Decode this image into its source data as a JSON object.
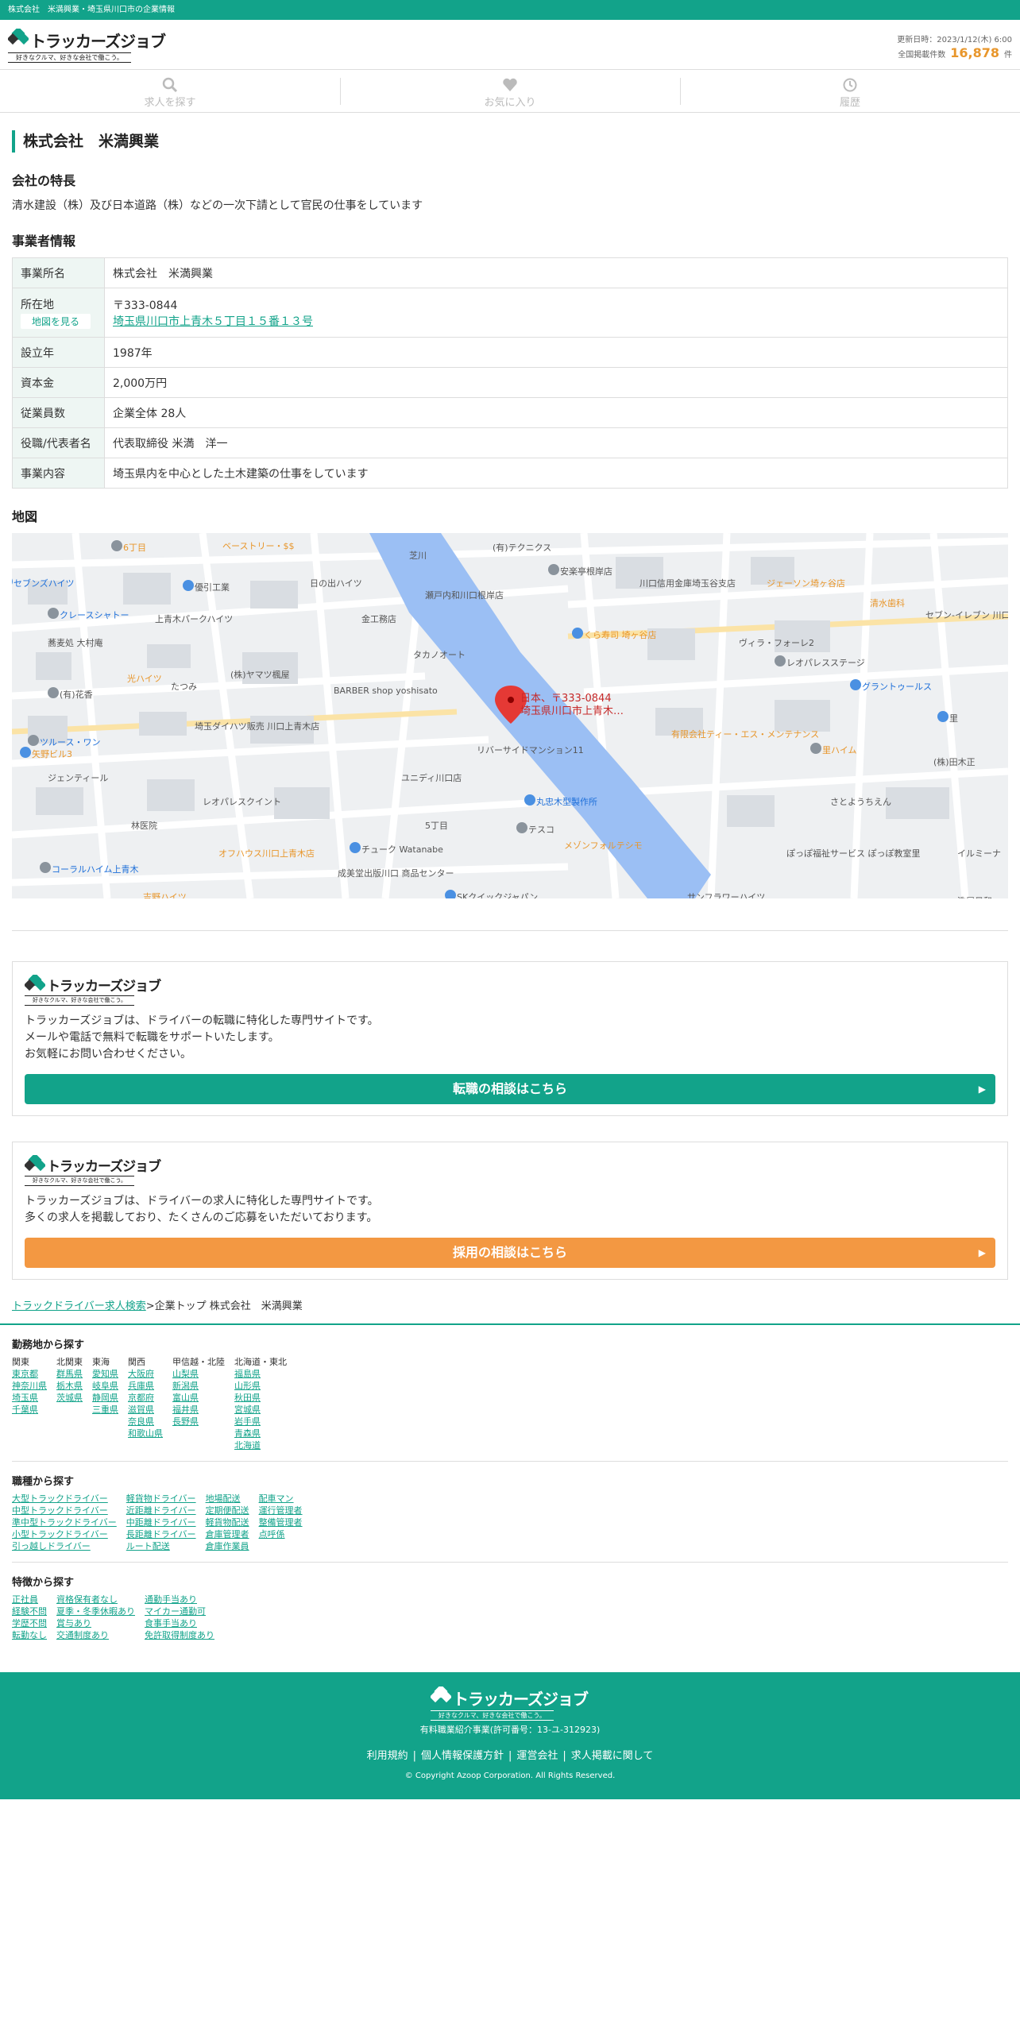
{
  "topbar": {
    "text": "株式会社　米満興業・埼玉県川口市の企業情報"
  },
  "header": {
    "logo_name": "トラッカーズジョブ",
    "logo_tagline": "好きなクルマ、好きな会社で働こう。",
    "updated": "更新日時：2023/1/12(木) 6:00",
    "count_label": "全国掲載件数",
    "count": "16,878",
    "count_unit": "件"
  },
  "nav": {
    "search": "求人を探す",
    "favorite": "お気に入り",
    "history": "履歴"
  },
  "company": {
    "name": "株式会社　米満興業",
    "feature_heading": "会社の特長",
    "feature": "清水建設（株）及び日本道路（株）などの一次下請として官民の仕事をしています",
    "info_heading": "事業者情報",
    "rows": [
      {
        "k": "事業所名",
        "v": "株式会社　米満興業"
      },
      {
        "k": "所在地",
        "zip": "〒333-0844",
        "addr": "埼玉県川口市上青木５丁目１５番１３号",
        "map_btn": "地図を見る"
      },
      {
        "k": "設立年",
        "v": "1987年"
      },
      {
        "k": "資本金",
        "v": "2,000万円"
      },
      {
        "k": "従業員数",
        "v": "企業全体 28人"
      },
      {
        "k": "役職/代表者名",
        "v": "代表取締役 米満　洋一"
      },
      {
        "k": "事業内容",
        "v": "埼玉県内を中心とした土木建築の仕事をしています"
      }
    ],
    "map_heading": "地図"
  },
  "map": {
    "pin_label1": "日本、〒333-0844",
    "pin_label2": "埼玉県川口市上青木…",
    "labels": [
      "6丁目",
      "ベーストリー・$$",
      "(有)テクニクス",
      "セブンズハイツ",
      "日の出ハイツ",
      "芝川",
      "安楽亭根岸店",
      "川口信用金庫埼玉谷支店",
      "ジェーソン埼ヶ谷店",
      "優引工業",
      "瀬戸内和川口根岸店",
      "清水歯科",
      "クレースシャトー",
      "上青木パークハイツ",
      "金工務店",
      "くら寿司 埼ヶ谷店",
      "セブン-イレブン 川口里中央店",
      "ヴィラ・フォーレ2",
      "レオパレスステージ",
      "蕎麦処 大村庵",
      "タカノオート",
      "グラントゥールス",
      "光ハイツ",
      "(株)ヤマツ楓屋",
      "(有)花香",
      "たつみ",
      "BARBER shop yoshisato",
      "里",
      "埼玉ダイハツ販売 川口上青木店",
      "有限会社ティー・エス・メンテナンス",
      "ツルース・ワン",
      "リバーサイドマンション11",
      "(株)田木正",
      "矢野ビル3",
      "ジェンティール",
      "ユニディ川口店",
      "里ハイム",
      "さとようちえん",
      "レオパレスクイント",
      "丸忠木型製作所",
      "林医院",
      "5丁目",
      "テスコ",
      "メゾンフォルテシモ",
      "オフハウス川口上青木店",
      "チューク Watanabe",
      "イルミーナ",
      "ぽっぽ福祉サービス ぽっぽ教室里",
      "コーラルハイム上青木",
      "成美堂出版川口 商品センター",
      "吉野ハイツ",
      "SKクイックジャパン",
      "サンフラワーハイツ",
      "洗屋日和"
    ]
  },
  "promo1": {
    "text": [
      "トラッカーズジョブは、ドライバーの転職に特化した専門サイトです。",
      "メールや電話で無料で転職をサポートいたします。",
      "お気軽にお問い合わせください。"
    ],
    "button": "転職の相談はこちら"
  },
  "promo2": {
    "text": [
      "トラッカーズジョブは、ドライバーの求人に特化した専門サイトです。",
      "多くの求人を掲載しており、たくさんのご応募をいただいております。"
    ],
    "button": "採用の相談はこちら"
  },
  "breadcrumb": {
    "link": "トラックドライバー求人検索",
    "sep": ">",
    "rest": "企業トップ 株式会社　米満興業"
  },
  "area": {
    "heading": "勤務地から探す",
    "cols": [
      {
        "h": "関東",
        "items": [
          "東京都",
          "神奈川県",
          "埼玉県",
          "千葉県"
        ]
      },
      {
        "h": "北関東",
        "items": [
          "群馬県",
          "栃木県",
          "茨城県"
        ]
      },
      {
        "h": "東海",
        "items": [
          "愛知県",
          "岐阜県",
          "静岡県",
          "三重県"
        ]
      },
      {
        "h": "関西",
        "items": [
          "大阪府",
          "兵庫県",
          "京都府",
          "滋賀県",
          "奈良県",
          "和歌山県"
        ]
      },
      {
        "h": "甲信越・北陸",
        "items": [
          "山梨県",
          "新潟県",
          "富山県",
          "福井県",
          "長野県"
        ]
      },
      {
        "h": "北海道・東北",
        "items": [
          "福島県",
          "山形県",
          "秋田県",
          "宮城県",
          "岩手県",
          "青森県",
          "北海道"
        ]
      }
    ]
  },
  "job": {
    "heading": "職種から探す",
    "cols": [
      {
        "items": [
          "大型トラックドライバー",
          "中型トラックドライバー",
          "準中型トラックドライバー",
          "小型トラックドライバー",
          "引っ越しドライバー"
        ]
      },
      {
        "items": [
          "軽貨物ドライバー",
          "近距離ドライバー",
          "中距離ドライバー",
          "長距離ドライバー",
          "ルート配送"
        ]
      },
      {
        "items": [
          "地場配送",
          "定期便配送",
          "軽貨物配送",
          "倉庫管理者",
          "倉庫作業員"
        ]
      },
      {
        "items": [
          "配車マン",
          "運行管理者",
          "整備管理者",
          "点呼係"
        ]
      }
    ]
  },
  "feature": {
    "heading": "特徴から探す",
    "cols": [
      {
        "items": [
          "正社員",
          "経験不問",
          "学歴不問",
          "転勤なし"
        ]
      },
      {
        "items": [
          "資格保有者なし",
          "夏季・冬季休暇あり",
          "賞与あり",
          "交通制度あり"
        ]
      },
      {
        "items": [
          "通勤手当あり",
          "マイカー通勤可",
          "食事手当あり",
          "免許取得制度あり"
        ]
      }
    ]
  },
  "footer": {
    "license": "有料職業紹介事業(許可番号：13-ユ-312923)",
    "links": [
      "利用規約",
      "個人情報保護方針",
      "運営会社",
      "求人掲載に関して"
    ],
    "copyright": "© Copyright Azoop Corporation. All Rights Reserved."
  },
  "colors": {
    "brand": "#12a38a",
    "accent": "#f39842"
  }
}
